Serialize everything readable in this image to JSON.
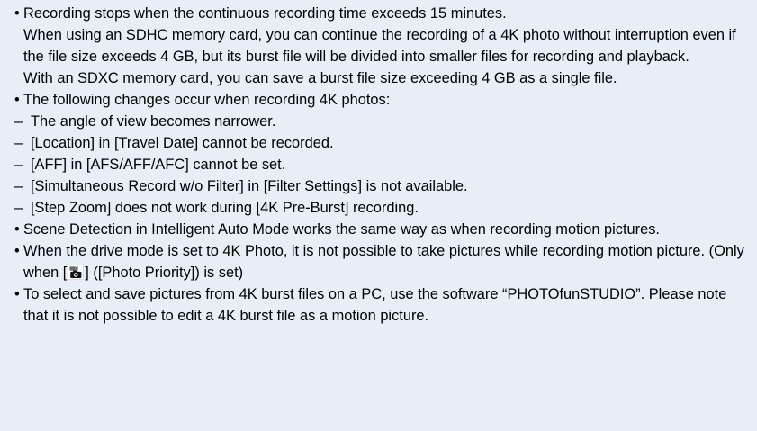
{
  "bullet_symbol": "•",
  "dash_symbol": "–",
  "icon_names": {
    "photo_priority": "movie-camera-photo-priority-icon"
  },
  "notes": {
    "recording_limit": {
      "lead": "Recording stops when the continuous recording time exceeds 15 minutes.",
      "sdhc": "When using an SDHC memory card, you can continue the recording of a 4K photo without interruption even if the file size exceeds 4 GB, but its burst file will be divided into smaller files for recording and playback.",
      "sdxc": "With an SDXC memory card, you can save a burst file size exceeding 4 GB as a single file."
    },
    "changes": {
      "lead": "The following changes occur when recording 4K photos:",
      "items": [
        "The angle of view becomes narrower.",
        "[Location] in [Travel Date] cannot be recorded.",
        "[AFF] in [AFS/AFF/AFC] cannot be set.",
        "[Simultaneous Record w/o Filter] in [Filter Settings] is not available.",
        "[Step Zoom] does not work during [4K Pre-Burst] recording."
      ]
    },
    "scene_detection": "Scene Detection in Intelligent Auto Mode works the same way as when recording motion pictures.",
    "drive_mode": {
      "before_icon": "When the drive mode is set to 4K Photo, it is not possible to take pictures while recording motion picture. (Only when [",
      "after_icon": "] ([Photo Priority]) is set)"
    },
    "software": "To select and save pictures from 4K burst files on a PC, use the software “PHOTOfunSTUDIO”. Please note that it is not possible to edit a 4K burst file as a motion picture."
  }
}
